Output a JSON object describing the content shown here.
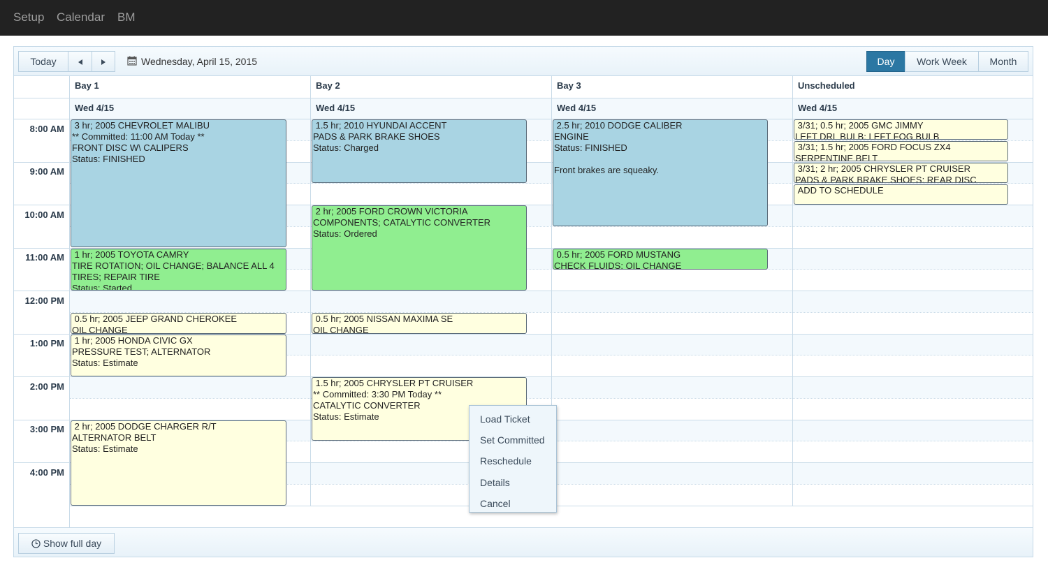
{
  "nav": {
    "items": [
      "Setup",
      "Calendar",
      "BM"
    ]
  },
  "toolbar": {
    "today_label": "Today",
    "prev_icon": "triangle-left",
    "next_icon": "triangle-right",
    "date_icon": "calendar-icon",
    "date_text": "Wednesday, April 15, 2015",
    "views": [
      "Day",
      "Work Week",
      "Month"
    ],
    "active_view": "Day"
  },
  "resources": [
    "Bay 1",
    "Bay 2",
    "Bay 3",
    "Unscheduled"
  ],
  "date_header": "Wed 4/15",
  "times": [
    "8:00 AM",
    "9:00 AM",
    "10:00 AM",
    "11:00 AM",
    "12:00 PM",
    "1:00 PM",
    "2:00 PM",
    "3:00 PM",
    "4:00 PM"
  ],
  "events": {
    "bay1": [
      {
        "lines": [
          " 3 hr; 2005 CHEVROLET MALIBU",
          "** Committed: 11:00 AM Today **",
          "FRONT DISC W\\ CALIPERS",
          "Status: FINISHED"
        ],
        "status_color": "blue"
      },
      {
        "lines": [
          " 1 hr; 2005 TOYOTA CAMRY",
          "TIRE ROTATION; OIL CHANGE; BALANCE ALL 4 TIRES; REPAIR TIRE",
          "Status: Started"
        ],
        "status_color": "green"
      },
      {
        "lines": [
          " 0.5 hr; 2005 JEEP GRAND CHEROKEE",
          "OIL CHANGE"
        ],
        "status_color": "yellow"
      },
      {
        "lines": [
          " 1 hr; 2005 HONDA CIVIC GX",
          "PRESSURE TEST; ALTERNATOR",
          "Status: Estimate"
        ],
        "status_color": "yellow"
      },
      {
        "lines": [
          " 2 hr; 2005 DODGE CHARGER R/T",
          "ALTERNATOR BELT",
          "Status: Estimate"
        ],
        "status_color": "yellow"
      }
    ],
    "bay2": [
      {
        "lines": [
          " 1.5 hr; 2010 HYUNDAI ACCENT",
          "PADS & PARK BRAKE SHOES",
          "Status: Charged"
        ],
        "status_color": "blue"
      },
      {
        "lines": [
          " 2 hr; 2005 FORD CROWN VICTORIA",
          "COMPONENTS; CATALYTIC CONVERTER",
          "Status: Ordered"
        ],
        "status_color": "green"
      },
      {
        "lines": [
          " 0.5 hr; 2005 NISSAN MAXIMA SE",
          "OIL CHANGE"
        ],
        "status_color": "yellow"
      },
      {
        "lines": [
          " 1.5 hr; 2005 CHRYSLER PT CRUISER",
          "** Committed: 3:30 PM Today **",
          "CATALYTIC CONVERTER",
          "Status: Estimate"
        ],
        "status_color": "yellow"
      }
    ],
    "bay3": [
      {
        "lines": [
          " 2.5 hr; 2010 DODGE CALIBER",
          "ENGINE",
          "Status: FINISHED",
          "",
          "Front brakes are squeaky."
        ],
        "status_color": "blue"
      },
      {
        "lines": [
          " 0.5 hr; 2005 FORD MUSTANG",
          "CHECK FLUIDS; OIL CHANGE"
        ],
        "status_color": "green"
      }
    ],
    "unscheduled": [
      {
        "lines": [
          " 3/31; 0.5 hr; 2005 GMC JIMMY",
          "LEFT DRL BULB; LEFT FOG BULB"
        ],
        "status_color": "yellow"
      },
      {
        "lines": [
          " 3/31; 1.5 hr; 2005 FORD FOCUS ZX4",
          "SERPENTINE BELT"
        ],
        "status_color": "yellow"
      },
      {
        "lines": [
          " 3/31; 2 hr; 2005 CHRYSLER PT CRUISER",
          "PADS & PARK BRAKE SHOES; REAR DISC"
        ],
        "status_color": "yellow"
      },
      {
        "lines": [
          " ADD TO SCHEDULE"
        ],
        "status_color": "yellow"
      }
    ]
  },
  "context_menu": [
    "Load Ticket",
    "Set Committed",
    "Reschedule",
    "Details",
    "Cancel"
  ],
  "footer": {
    "show_full_day_label": "Show full day",
    "icon": "clock-icon"
  }
}
